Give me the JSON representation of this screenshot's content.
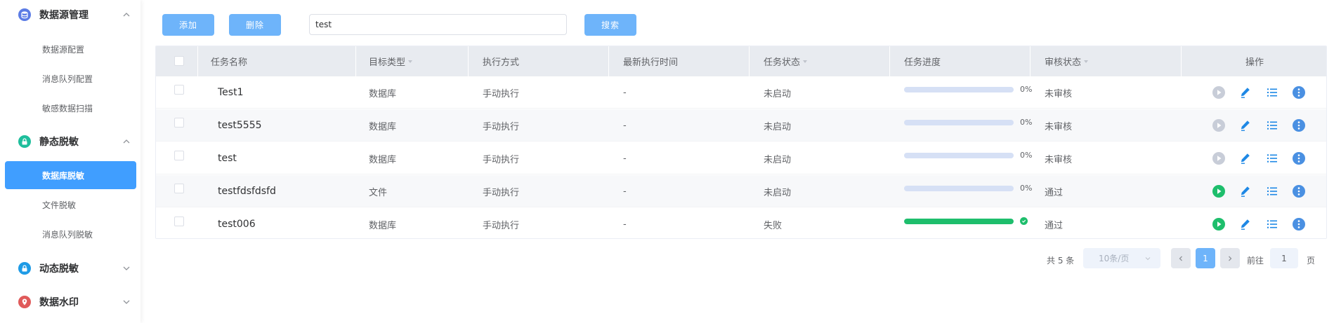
{
  "sidebar": {
    "groups": [
      {
        "label": "数据源管理",
        "icon": "database-icon",
        "color": "#5b7ce5",
        "expanded": true,
        "items": [
          "数据源配置",
          "消息队列配置",
          "敏感数据扫描"
        ]
      },
      {
        "label": "静态脱敏",
        "icon": "lock-icon",
        "color": "#1ebe9c",
        "expanded": true,
        "items": [
          "数据库脱敏",
          "文件脱敏",
          "消息队列脱敏"
        ]
      },
      {
        "label": "动态脱敏",
        "icon": "lock-icon",
        "color": "#1e9be6",
        "expanded": false,
        "items": []
      },
      {
        "label": "数据水印",
        "icon": "location-pin-icon",
        "color": "#e05a5a",
        "expanded": false,
        "items": []
      }
    ],
    "active_item": "数据库脱敏"
  },
  "toolbar": {
    "add_label": "添加",
    "delete_label": "删除",
    "search_value": "test",
    "search_button_label": "搜索"
  },
  "table": {
    "columns": [
      {
        "label": "任务名称",
        "sortable": false
      },
      {
        "label": "目标类型",
        "sortable": true
      },
      {
        "label": "执行方式",
        "sortable": false
      },
      {
        "label": "最新执行时间",
        "sortable": false
      },
      {
        "label": "任务状态",
        "sortable": true
      },
      {
        "label": "任务进度",
        "sortable": false
      },
      {
        "label": "审核状态",
        "sortable": true
      },
      {
        "label": "操作",
        "sortable": false
      }
    ],
    "rows": [
      {
        "name": "Test1",
        "target": "数据库",
        "mode": "手动执行",
        "last_run": "-",
        "status": "未启动",
        "progress": 0,
        "progress_text": "0%",
        "review": "未审核",
        "run_enabled": false
      },
      {
        "name": "test5555",
        "target": "数据库",
        "mode": "手动执行",
        "last_run": "-",
        "status": "未启动",
        "progress": 0,
        "progress_text": "0%",
        "review": "未审核",
        "run_enabled": false
      },
      {
        "name": "test",
        "target": "数据库",
        "mode": "手动执行",
        "last_run": "-",
        "status": "未启动",
        "progress": 0,
        "progress_text": "0%",
        "review": "未审核",
        "run_enabled": false
      },
      {
        "name": "testfdsfdsfd",
        "target": "文件",
        "mode": "手动执行",
        "last_run": "-",
        "status": "未启动",
        "progress": 0,
        "progress_text": "0%",
        "review": "通过",
        "run_enabled": true
      },
      {
        "name": "test006",
        "target": "数据库",
        "mode": "手动执行",
        "last_run": "-",
        "status": "失败",
        "progress": 100,
        "progress_text": "",
        "review": "通过",
        "run_enabled": true
      }
    ]
  },
  "pagination": {
    "total_text": "共 5 条",
    "page_size": "10条/页",
    "current_page": "1",
    "goto_label": "前往",
    "goto_value": "1",
    "page_unit": "页"
  },
  "colors": {
    "primary": "#409eff",
    "button": "#6eb4fa",
    "success": "#1ebe6c",
    "icon_blue": "#1e88e5",
    "disabled": "#c8cdd8"
  }
}
